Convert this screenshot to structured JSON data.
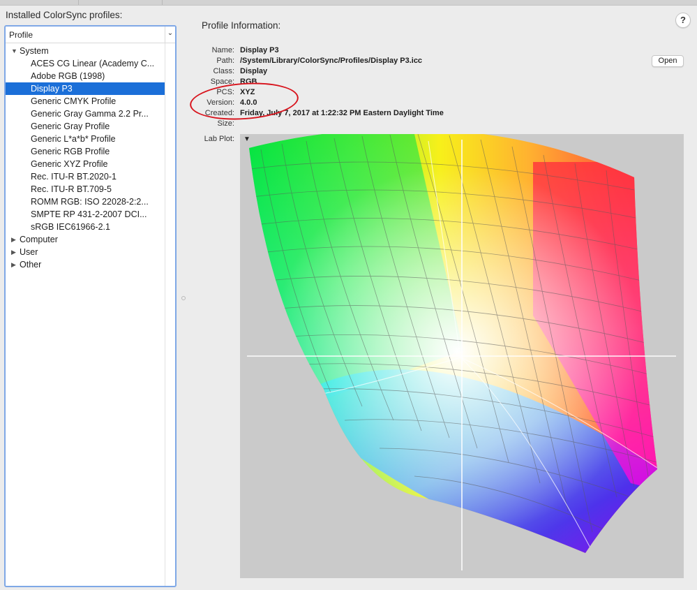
{
  "installed_label": "Installed ColorSync profiles:",
  "list": {
    "header_label": "Profile",
    "header_button": "⌄",
    "groups": [
      {
        "label": "System",
        "expanded": true,
        "items": [
          "ACES CG Linear (Academy C...",
          "Adobe RGB (1998)",
          "Display P3",
          "Generic CMYK Profile",
          "Generic Gray Gamma 2.2 Pr...",
          "Generic Gray Profile",
          "Generic L*a*b* Profile",
          "Generic RGB Profile",
          "Generic XYZ Profile",
          "Rec. ITU-R BT.2020-1",
          "Rec. ITU-R BT.709-5",
          "ROMM RGB: ISO 22028-2:2...",
          "SMPTE RP 431-2-2007 DCI...",
          "sRGB IEC61966-2.1"
        ],
        "selected": "Display P3"
      },
      {
        "label": "Computer",
        "expanded": false
      },
      {
        "label": "User",
        "expanded": false
      },
      {
        "label": "Other",
        "expanded": false
      }
    ]
  },
  "help_label": "?",
  "info": {
    "title": "Profile Information:",
    "name_label": "Name:",
    "name": "Display P3",
    "path_label": "Path:",
    "path": "/System/Library/ColorSync/Profiles/Display P3.icc",
    "class_label": "Class:",
    "class": "Display",
    "space_label": "Space:",
    "space": "RGB",
    "pcs_label": "PCS:",
    "pcs": "XYZ",
    "version_label": "Version:",
    "version": "4.0.0",
    "created_label": "Created:",
    "created": "Friday, July 7, 2017 at 1:22:32 PM Eastern Daylight Time",
    "size_label": "Size:",
    "size": "",
    "open_label": "Open",
    "labplot_label": "Lab Plot:",
    "plot_menu_icon": "▼"
  },
  "colors": {
    "selection": "#1b6fd8",
    "annotation": "#d8141d",
    "plot_background": "#cacaca"
  }
}
